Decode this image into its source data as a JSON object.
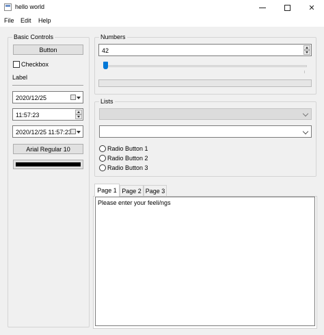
{
  "window": {
    "title": "hello world",
    "minimize": "—",
    "maximize": "☐",
    "close": "✕"
  },
  "menu": {
    "items": [
      "File",
      "Edit",
      "Help"
    ]
  },
  "basic_controls": {
    "title": "Basic Controls",
    "button_label": "Button",
    "checkbox_label": "Checkbox",
    "checkbox_checked": false,
    "label_text": "Label",
    "date_value": "2020/12/25",
    "time_value": "11:57:23",
    "datetime_value": "2020/12/25 11:57:23",
    "font_button_label": "Arial Regular 10",
    "color_value": "#000000"
  },
  "numbers": {
    "title": "Numbers",
    "spinbox_value": "42",
    "slider_value_percent": 0,
    "progress_value_percent": 0
  },
  "lists": {
    "title": "Lists",
    "combo_disabled_value": "",
    "combo_value": "",
    "radio_buttons": [
      {
        "label": "Radio Button 1",
        "checked": false
      },
      {
        "label": "Radio Button 2",
        "checked": false
      },
      {
        "label": "Radio Button 3",
        "checked": false
      }
    ]
  },
  "tabs": {
    "items": [
      "Page 1",
      "Page 2",
      "Page 3"
    ],
    "active": 0,
    "text_content": "Please enter your feeli/ngs"
  }
}
